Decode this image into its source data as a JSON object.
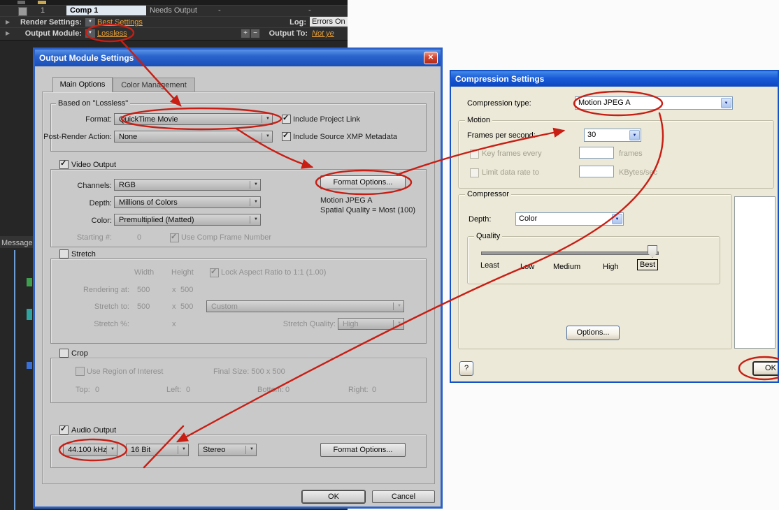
{
  "render_queue": {
    "row_index": "1",
    "comp_name": "Comp 1",
    "status": "Needs Output",
    "dash": "-",
    "render_settings_label": "Render Settings:",
    "render_settings_value": "Best Settings",
    "log_label": "Log:",
    "log_value": "Errors On",
    "output_module_label": "Output Module:",
    "output_module_value": "Lossless",
    "output_to_label": "Output To:",
    "output_to_value": "Not ye",
    "message_label": "Message"
  },
  "oms": {
    "title": "Output Module Settings",
    "tabs": [
      "Main Options",
      "Color Management"
    ],
    "based_on": "Based on \"Lossless\"",
    "format_label": "Format:",
    "format_value": "QuickTime Movie",
    "include_project_link": "Include Project Link",
    "post_render_label": "Post-Render Action:",
    "post_render_value": "None",
    "include_xmp": "Include Source XMP Metadata",
    "video_output_label": "Video Output",
    "channels_label": "Channels:",
    "channels_value": "RGB",
    "format_options_label": "Format Options...",
    "depth_label": "Depth:",
    "depth_value": "Millions of Colors",
    "codec_line1": "Motion JPEG A",
    "codec_line2": "Spatial Quality = Most (100)",
    "color_label": "Color:",
    "color_value": "Premultiplied (Matted)",
    "starting_label": "Starting #:",
    "starting_value": "0",
    "use_comp_frame": "Use Comp Frame Number",
    "stretch_label": "Stretch",
    "width_label": "Width",
    "height_label": "Height",
    "lock_aspect": "Lock Aspect Ratio to 1:1 (1.00)",
    "rendering_at_label": "Rendering at:",
    "rendering_w": "500",
    "times": "x",
    "rendering_h": "500",
    "stretch_to_label": "Stretch to:",
    "stretch_w": "500",
    "stretch_h": "500",
    "stretch_preset": "Custom",
    "stretch_pct_label": "Stretch %:",
    "stretch_quality_label": "Stretch Quality:",
    "stretch_quality_value": "High",
    "crop_label": "Crop",
    "use_roi": "Use Region of Interest",
    "final_size": "Final Size: 500 x 500",
    "top_label": "Top:",
    "top_value": "0",
    "left_label": "Left:",
    "left_value": "0",
    "bottom_label": "Bottom:",
    "bottom_value": "0",
    "right_label": "Right:",
    "right_value": "0",
    "audio_output_label": "Audio Output",
    "audio_rate": "44.100 kHz",
    "audio_depth": "16 Bit",
    "audio_channels": "Stereo",
    "audio_format_options": "Format Options...",
    "ok": "OK",
    "cancel": "Cancel"
  },
  "cs": {
    "title": "Compression Settings",
    "compression_type_label": "Compression type:",
    "compression_type_value": "Motion JPEG A",
    "motion_label": "Motion",
    "fps_label": "Frames per second:",
    "fps_value": "30",
    "keyframes_label": "Key frames every",
    "frames_label": "frames",
    "limit_label": "Limit data rate to",
    "kbytes_label": "KBytes/sec",
    "compressor_label": "Compressor",
    "depth_label": "Depth:",
    "depth_value": "Color",
    "quality_label": "Quality",
    "quality_labels": [
      "Least",
      "Low",
      "Medium",
      "High",
      "Best"
    ],
    "options_label": "Options...",
    "help_label": "?",
    "ok": "OK"
  },
  "icons": {
    "close": "✕",
    "dropdown": "▼",
    "expand": "▶",
    "plus": "+",
    "minus": "−"
  },
  "colors": {
    "annotation": "#c81e14",
    "accent_orange": "#e8a23b"
  }
}
